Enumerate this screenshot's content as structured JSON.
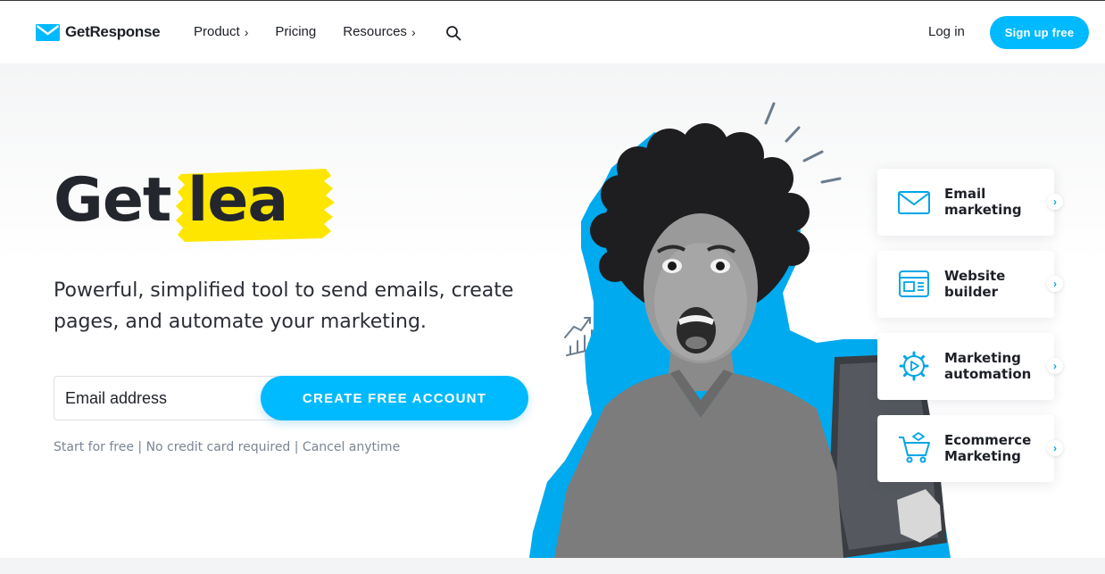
{
  "brand": {
    "name": "GetResponse",
    "accent": "#00baff",
    "highlight": "#ffe600"
  },
  "nav": {
    "items": [
      {
        "label": "Product",
        "chevron": "›"
      },
      {
        "label": "Pricing",
        "chevron": ""
      },
      {
        "label": "Resources",
        "chevron": "›"
      }
    ],
    "search_icon": "search-icon",
    "login_label": "Log in",
    "signup_label": "Sign up free"
  },
  "hero": {
    "headline_prefix": "Get",
    "headline_highlight": "lea",
    "subhead": "Powerful, simplified tool to send emails, create pages, and automate your marketing.",
    "email_placeholder": "Email address",
    "cta_label": "CREATE FREE ACCOUNT",
    "fineprint": "Start for free | No credit card required | Cancel anytime"
  },
  "features": [
    {
      "label": "Email marketing",
      "icon": "envelope-icon"
    },
    {
      "label": "Website builder",
      "icon": "website-icon"
    },
    {
      "label": "Marketing automation",
      "icon": "gear-play-icon"
    },
    {
      "label": "Ecommerce Marketing",
      "icon": "cart-icon"
    }
  ],
  "feature_arrow": "›"
}
